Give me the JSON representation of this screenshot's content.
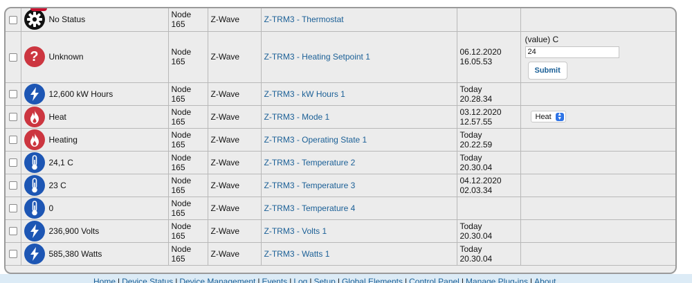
{
  "devices": [
    {
      "icon": "gear-icon",
      "icon_style": "black",
      "status": "No Status",
      "node": "Node 165",
      "type": "Z-Wave",
      "name": "Z-TRM3 - Thermostat",
      "date": "",
      "time": "",
      "control": "none"
    },
    {
      "icon": "question-icon",
      "icon_style": "red",
      "status": "Unknown",
      "node": "Node 165",
      "type": "Z-Wave",
      "name": "Z-TRM3 - Heating Setpoint 1",
      "date": "06.12.2020",
      "time": "16.05.53",
      "control": "input"
    },
    {
      "icon": "bolt-icon",
      "icon_style": "blue",
      "status": "12,600 kW Hours",
      "node": "Node 165",
      "type": "Z-Wave",
      "name": "Z-TRM3 - kW Hours 1",
      "date": "Today",
      "time": "20.28.34",
      "control": "none"
    },
    {
      "icon": "flame-icon",
      "icon_style": "red",
      "status": "Heat",
      "node": "Node 165",
      "type": "Z-Wave",
      "name": "Z-TRM3 - Mode 1",
      "date": "03.12.2020",
      "time": "12.57.55",
      "control": "select"
    },
    {
      "icon": "flame-icon",
      "icon_style": "red",
      "status": "Heating",
      "node": "Node 165",
      "type": "Z-Wave",
      "name": "Z-TRM3 - Operating State 1",
      "date": "Today",
      "time": "20.22.59",
      "control": "none"
    },
    {
      "icon": "thermometer-icon",
      "icon_style": "blue",
      "status": "24,1 C",
      "node": "Node 165",
      "type": "Z-Wave",
      "name": "Z-TRM3 - Temperature 2",
      "date": "Today",
      "time": "20.30.04",
      "control": "none"
    },
    {
      "icon": "thermometer-icon",
      "icon_style": "blue",
      "status": "23 C",
      "node": "Node 165",
      "type": "Z-Wave",
      "name": "Z-TRM3 - Temperature 3",
      "date": "04.12.2020",
      "time": "02.03.34",
      "control": "none"
    },
    {
      "icon": "thermometer-icon",
      "icon_style": "blue",
      "status": "0",
      "node": "Node 165",
      "type": "Z-Wave",
      "name": "Z-TRM3 - Temperature 4",
      "date": "",
      "time": "",
      "control": "none"
    },
    {
      "icon": "bolt-icon",
      "icon_style": "blue",
      "status": "236,900 Volts",
      "node": "Node 165",
      "type": "Z-Wave",
      "name": "Z-TRM3 - Volts 1",
      "date": "Today",
      "time": "20.30.04",
      "control": "none"
    },
    {
      "icon": "bolt-icon",
      "icon_style": "blue",
      "status": "585,380 Watts",
      "node": "Node 165",
      "type": "Z-Wave",
      "name": "Z-TRM3 - Watts 1",
      "date": "Today",
      "time": "20.30.04",
      "control": "none"
    }
  ],
  "setpoint_control": {
    "label": "(value) C",
    "value": "24",
    "submit_label": "Submit"
  },
  "mode_control": {
    "selected": "Heat"
  },
  "footer": {
    "links": [
      "Home",
      "Device Status",
      "Device Management",
      "Events",
      "Log",
      "Setup",
      "Global Elements",
      "Control Panel",
      "Manage Plug-ins",
      "About"
    ]
  },
  "colors": {
    "link": "#1a5f96",
    "red_icon": "#cc3640",
    "blue_icon": "#1d56b4",
    "black_icon": "#111111",
    "table_bg": "#ececec",
    "footer_bg": "#dcebf6"
  }
}
